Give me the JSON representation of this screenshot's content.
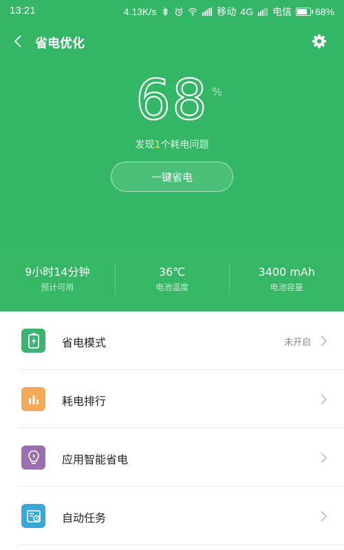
{
  "status_bar": {
    "time": "13:21",
    "speed": "4.13K/s",
    "carrier1": "移动",
    "network": "4G",
    "carrier2": "电信",
    "battery": "68%",
    "battery_level": 0.68,
    "icons": [
      "bluetooth-icon",
      "alarm-icon",
      "wifi-icon",
      "hd-signal-icon",
      "signal-icon"
    ]
  },
  "header": {
    "title": "省电优化",
    "back_icon": "chevron-left-icon",
    "settings_icon": "gear-icon"
  },
  "battery": {
    "percent": "68",
    "unit": "%",
    "issue_prefix": "发现",
    "issue_count": "1",
    "issue_suffix": "个耗电问题",
    "one_click_label": "一键省电"
  },
  "stats": [
    {
      "value": "9小时14分钟",
      "label": "预计可用"
    },
    {
      "value": "36℃",
      "label": "电池温度"
    },
    {
      "value": "3400 mAh",
      "label": "电池容量"
    }
  ],
  "list": [
    {
      "label": "省电模式",
      "value": "未开启",
      "icon": "battery-bolt-icon",
      "color": "#3cb371"
    },
    {
      "label": "耗电排行",
      "value": "",
      "icon": "bar-chart-icon",
      "color": "#f5a95a"
    },
    {
      "label": "应用智能省电",
      "value": "",
      "icon": "lightbulb-icon",
      "color": "#9a6fb0"
    },
    {
      "label": "自动任务",
      "value": "",
      "icon": "task-clock-icon",
      "color": "#37a8d8"
    }
  ],
  "colors": {
    "primary_green": "#33b665",
    "highlight_yellow": "#f7e94a"
  }
}
